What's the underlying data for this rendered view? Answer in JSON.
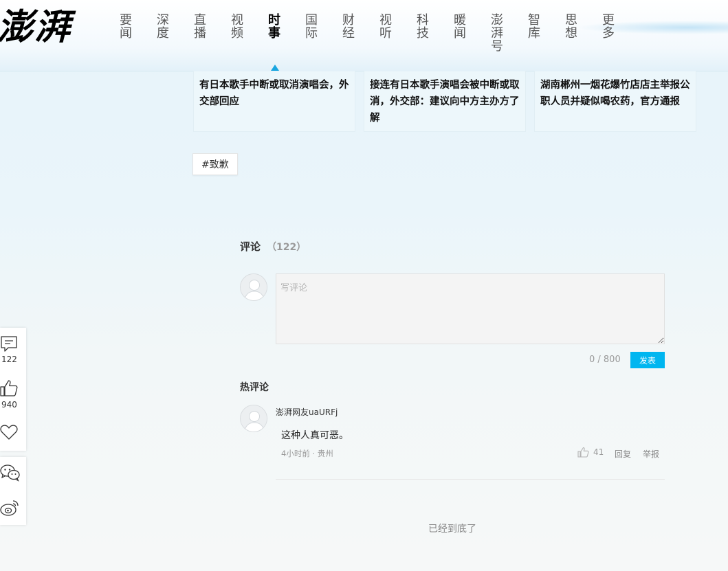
{
  "header": {
    "logo": "澎湃",
    "nav": [
      {
        "label": [
          "要",
          "闻"
        ],
        "active": false
      },
      {
        "label": [
          "深",
          "度"
        ],
        "active": false
      },
      {
        "label": [
          "直",
          "播"
        ],
        "active": false
      },
      {
        "label": [
          "视",
          "频"
        ],
        "active": false
      },
      {
        "label": [
          "时",
          "事"
        ],
        "active": true
      },
      {
        "label": [
          "国",
          "际"
        ],
        "active": false
      },
      {
        "label": [
          "财",
          "经"
        ],
        "active": false
      },
      {
        "label": [
          "视",
          "听"
        ],
        "active": false
      },
      {
        "label": [
          "科",
          "技"
        ],
        "active": false
      },
      {
        "label": [
          "暖",
          "闻"
        ],
        "active": false
      },
      {
        "label": [
          "澎",
          "湃",
          "号"
        ],
        "active": false
      },
      {
        "label": [
          "智",
          "库"
        ],
        "active": false
      },
      {
        "label": [
          "思",
          "想"
        ],
        "active": false
      },
      {
        "label": [
          "更",
          "多"
        ],
        "active": false
      }
    ]
  },
  "related": [
    {
      "title": "有日本歌手中断或取消演唱会，外交部回应"
    },
    {
      "title": "接连有日本歌手演唱会被中断或取消，外交部：建议向中方主办方了解"
    },
    {
      "title": "湖南郴州一烟花爆竹店店主举报公职人员并疑似喝农药，官方通报"
    }
  ],
  "tag": "#致歉",
  "comments": {
    "title": "评论",
    "count": "（122）",
    "placeholder": "写评论",
    "counter": "0 / 800",
    "submit_label": "发表",
    "hot_title": "热评论",
    "items": [
      {
        "user": "澎湃网友uaURFj",
        "text": "这种人真可恶。",
        "meta": "4小时前 · 贵州",
        "likes": "41",
        "reply_label": "回复",
        "report_label": "举报"
      }
    ],
    "end_text": "已经到底了"
  },
  "side_toolbar": {
    "comment_count": "122",
    "like_count": "940"
  },
  "colors": {
    "accent": "#00b6f0",
    "nav_active_mark": "#19a5e0"
  }
}
